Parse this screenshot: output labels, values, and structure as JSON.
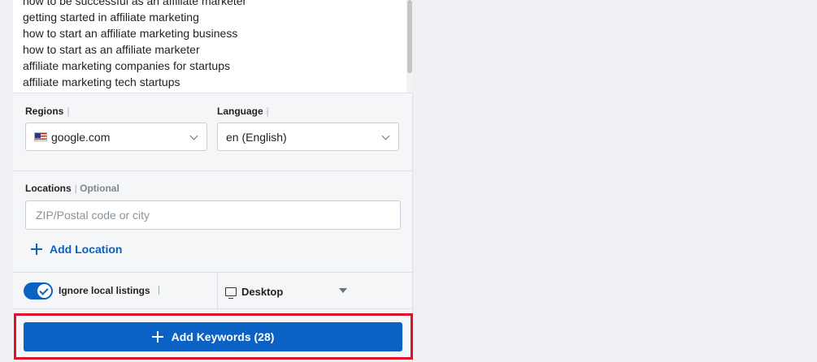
{
  "keywords": [
    "how to be successful as an affiliate marketer",
    "getting started in affiliate marketing",
    "how to start an affiliate marketing business",
    "how to start as an affiliate marketer",
    "affiliate marketing companies for startups",
    "affiliate marketing tech startups"
  ],
  "regions": {
    "label": "Regions",
    "value": "google.com",
    "flag_icon": "us-flag-icon"
  },
  "language": {
    "label": "Language",
    "value": "en (English)"
  },
  "locations": {
    "label": "Locations",
    "optional": "Optional",
    "placeholder": "ZIP/Postal code or city",
    "add_label": "Add Location"
  },
  "options": {
    "ignore_local_label": "Ignore local listings",
    "ignore_local_checked": true,
    "device_label": "Desktop"
  },
  "add_button": {
    "label": "Add Keywords (28)"
  },
  "colors": {
    "accent": "#0b62c4",
    "highlight": "#e0102a"
  }
}
